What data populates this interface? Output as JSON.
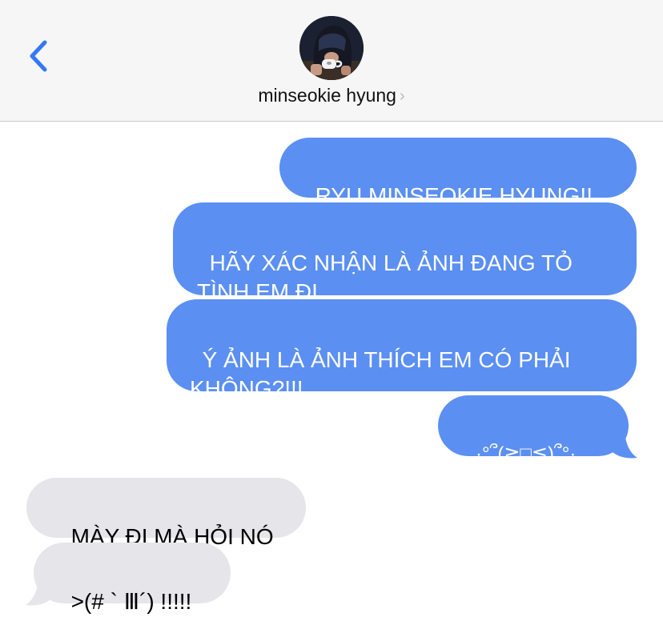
{
  "header": {
    "back_icon": "chevron-left-icon",
    "contact_name": "minseokie hyung",
    "name_chevron": "›",
    "accent_color": "#3478f6"
  },
  "messages": [
    {
      "direction": "outgoing",
      "text": "RYU MINSEOKIE HYUNG!!"
    },
    {
      "direction": "outgoing",
      "text": "HÃY XÁC NHẬN LÀ ẢNH ĐANG TỎ TÌNH EM ĐI"
    },
    {
      "direction": "outgoing",
      "text": "Ý ẢNH LÀ ẢNH THÍCH EM CÓ PHẢI KHÔNG?!!!"
    },
    {
      "direction": "outgoing",
      "text": ".·°՞(≧□≦)՞°·."
    },
    {
      "direction": "incoming",
      "text": "MÀY ĐI MÀ HỎI NÓ"
    },
    {
      "direction": "incoming",
      "text": ">(# ` Ⅲ´) !!!!!"
    }
  ],
  "colors": {
    "outgoing_bubble": "#5b8ff2",
    "incoming_bubble": "#e5e5ea",
    "header_bg": "#f6f6f6"
  }
}
